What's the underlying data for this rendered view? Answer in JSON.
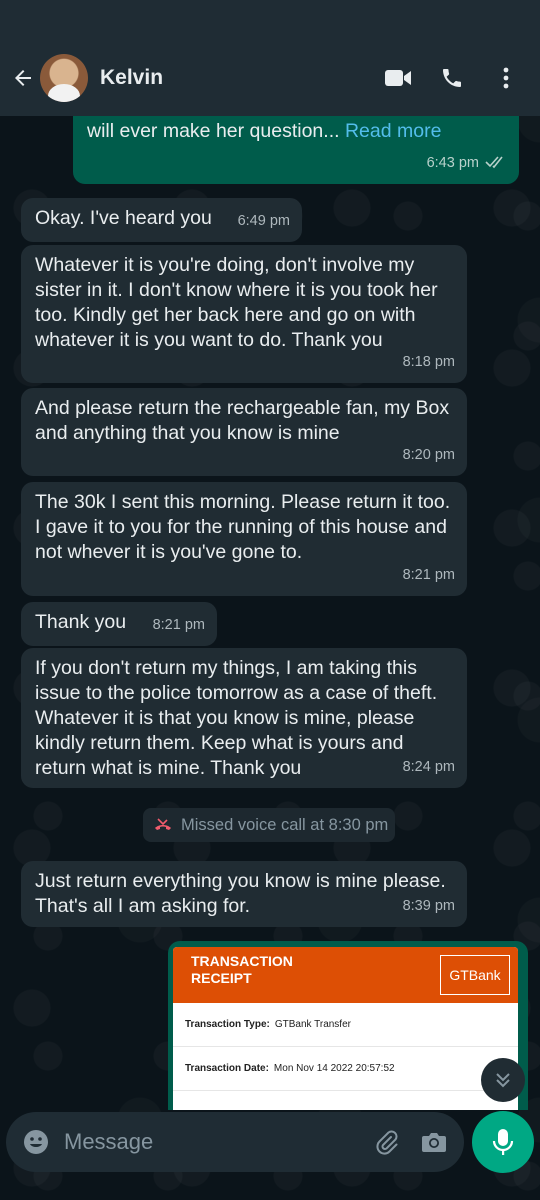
{
  "header": {
    "contact_name": "Kelvin"
  },
  "messages": {
    "m0": {
      "text": "self esteem, we should be the last people who will ever make her question...",
      "link": "Read more",
      "time": "6:43 pm"
    },
    "m1": {
      "text": "Okay. I've heard you",
      "time": "6:49 pm"
    },
    "m2": {
      "text": "Whatever it is you're doing, don't involve my sister in it. I don't know where it is you took her too. Kindly get her back here and go on with whatever it is you want to do. Thank you",
      "time": "8:18 pm"
    },
    "m3": {
      "text": "And please return the rechargeable fan, my Box and anything that you know is mine",
      "time": "8:20 pm"
    },
    "m4": {
      "text": "The 30k I sent this morning.  Please return it too. I gave it to you for the running of this house and not whever it is you've gone to.",
      "time": "8:21 pm"
    },
    "m5": {
      "text": "Thank you",
      "time": "8:21 pm"
    },
    "m6": {
      "text": "If you don't return my things, I am taking this issue to the police tomorrow as a case of theft. Whatever it is that you know is mine, please kindly return them. Keep what is yours and return what is mine. Thank you",
      "time": "8:24 pm"
    },
    "m7": {
      "text": "Just return everything you know is mine please.  That's all I am asking for.",
      "time": "8:39 pm"
    }
  },
  "system": {
    "missed_call": "Missed voice call at 8:30 pm"
  },
  "receipt": {
    "title": "TRANSACTION RECEIPT",
    "bank": "GTBank",
    "type_label": "Transaction Type:",
    "type_value": "GTBank Transfer",
    "date_label": "Transaction Date:",
    "date_value": "Mon Nov 14 2022 20:57:52"
  },
  "input": {
    "placeholder": "Message"
  },
  "colors": {
    "accent": "#00a884",
    "outgoing": "#005c4b",
    "incoming": "#202c33",
    "link": "#53bdeb",
    "bank": "#dd4f05"
  }
}
